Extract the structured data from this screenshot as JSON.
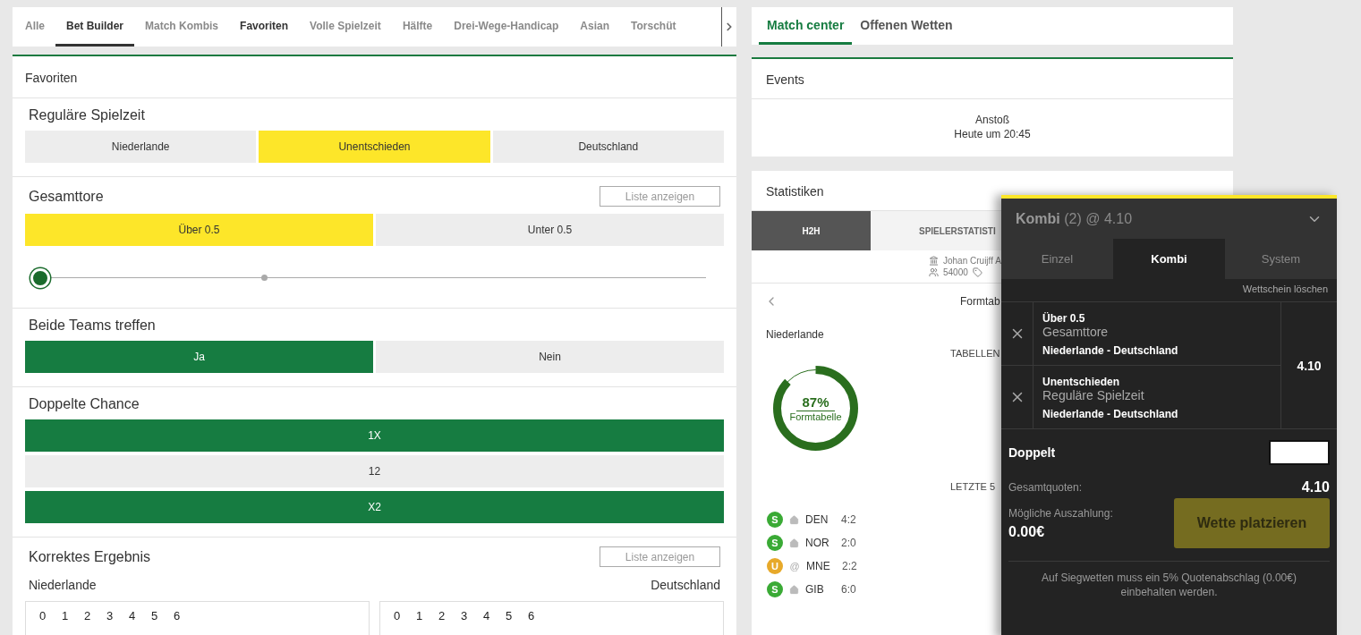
{
  "market_tabs": [
    {
      "label": "Alle",
      "selected": false,
      "highlighted": false
    },
    {
      "label": "Bet Builder",
      "selected": true,
      "highlighted": false
    },
    {
      "label": "Match Kombis",
      "selected": false,
      "highlighted": false
    },
    {
      "label": "Favoriten",
      "selected": false,
      "highlighted": true
    },
    {
      "label": "Volle Spielzeit",
      "selected": false,
      "highlighted": false
    },
    {
      "label": "Hälfte",
      "selected": false,
      "highlighted": false
    },
    {
      "label": "Drei-Wege-Handicap",
      "selected": false,
      "highlighted": false
    },
    {
      "label": "Asian",
      "selected": false,
      "highlighted": false
    },
    {
      "label": "Torschüt",
      "selected": false,
      "highlighted": false
    }
  ],
  "section_title": "Favoriten",
  "markets": [
    {
      "kind": "buttons",
      "title": "Reguläre Spielzeit",
      "options": [
        [
          {
            "label": "Niederlande",
            "selected": false,
            "in_betslip": false
          },
          {
            "label": "Unentschieden",
            "selected": false,
            "in_betslip": true
          },
          {
            "label": "Deutschland",
            "selected": false,
            "in_betslip": false
          }
        ]
      ]
    },
    {
      "kind": "slider",
      "title": "Gesamttore",
      "list_button": "Liste anzeigen",
      "options": [
        [
          {
            "label": "Über 0.5",
            "selected": false,
            "in_betslip": true
          },
          {
            "label": "Unter 0.5",
            "selected": false,
            "in_betslip": false
          }
        ]
      ],
      "level": 0
    },
    {
      "kind": "buttons",
      "title": "Beide Teams treffen",
      "options": [
        [
          {
            "label": "Ja",
            "selected": true,
            "in_betslip": false
          },
          {
            "label": "Nein",
            "selected": false,
            "in_betslip": false
          }
        ]
      ]
    },
    {
      "kind": "buttons",
      "title": "Doppelte Chance",
      "options": [
        [
          {
            "label": "1X",
            "selected": true,
            "in_betslip": false
          }
        ],
        [
          {
            "label": "12",
            "selected": false,
            "in_betslip": false
          }
        ],
        [
          {
            "label": "X2",
            "selected": true,
            "in_betslip": false
          }
        ]
      ]
    },
    {
      "kind": "score",
      "title": "Korrektes Ergebnis",
      "list_button": "Liste anzeigen",
      "home": "Niederlande",
      "away": "Deutschland",
      "home_goals": [
        "0",
        "1",
        "2",
        "3",
        "4",
        "5",
        "6"
      ],
      "away_goals": [
        "0",
        "1",
        "2",
        "3",
        "4",
        "5",
        "6"
      ]
    }
  ],
  "right_tabs": [
    {
      "label": "Match center",
      "selected": true
    },
    {
      "label": "Offenen Wetten",
      "selected": false
    }
  ],
  "events": {
    "title": "Events",
    "line_1": "Anstoß",
    "line_2": "Heute um 20:45"
  },
  "stats": {
    "title": "Statistiken",
    "tabs": [
      {
        "label": "H2H",
        "selected": true
      },
      {
        "label": "SPIELERSTATISTI",
        "selected": false
      }
    ],
    "venue": "Johan Cruijff A",
    "capacity": "54000",
    "nav_title": "Formtab",
    "team": "Niederlande",
    "table_heading": "TABELLEN",
    "form": {
      "level": 0.87,
      "percent": "87%",
      "label": "Formtabelle"
    },
    "last_heading": "LETZTE 5",
    "matches": [
      {
        "result": "S",
        "color": "#3aaa35",
        "kind": "home",
        "team": "DEN",
        "score": "4:2"
      },
      {
        "result": "S",
        "color": "#3aaa35",
        "kind": "home",
        "team": "NOR",
        "score": "2:0"
      },
      {
        "result": "U",
        "color": "#e7a92a",
        "kind": "away",
        "venue": "@",
        "team": "MNE",
        "score": "2:2"
      },
      {
        "result": "S",
        "color": "#3aaa35",
        "kind": "home",
        "team": "GIB",
        "score": "6:0"
      }
    ]
  },
  "betslip": {
    "header": "**Kombi** (2) @ 4.10",
    "tabs": [
      {
        "label": "Einzel",
        "selected": false
      },
      {
        "label": "Kombi",
        "selected": true
      },
      {
        "label": "System",
        "selected": false
      }
    ],
    "clear": "Wettschein löschen",
    "bets": [
      {
        "selection": "Über 0.5",
        "market": "Gesamttore",
        "event": "Niederlande - Deutschland"
      },
      {
        "selection": "Unentschieden",
        "market": "Reguläre Spielzeit",
        "event": "Niederlande - Deutschland"
      }
    ],
    "odds": "4.10",
    "stake_label": "Doppelt",
    "total_label": "Gesamtquoten:",
    "total": "4.10",
    "payout_label": "Mögliche Auszahlung:",
    "payout": "0.00€",
    "place_button": "Wette platzieren",
    "place_disabled": true,
    "note": "Auf Siegwetten muss ein 5% Quotenabschlag (0.00€) einbehalten werden."
  }
}
